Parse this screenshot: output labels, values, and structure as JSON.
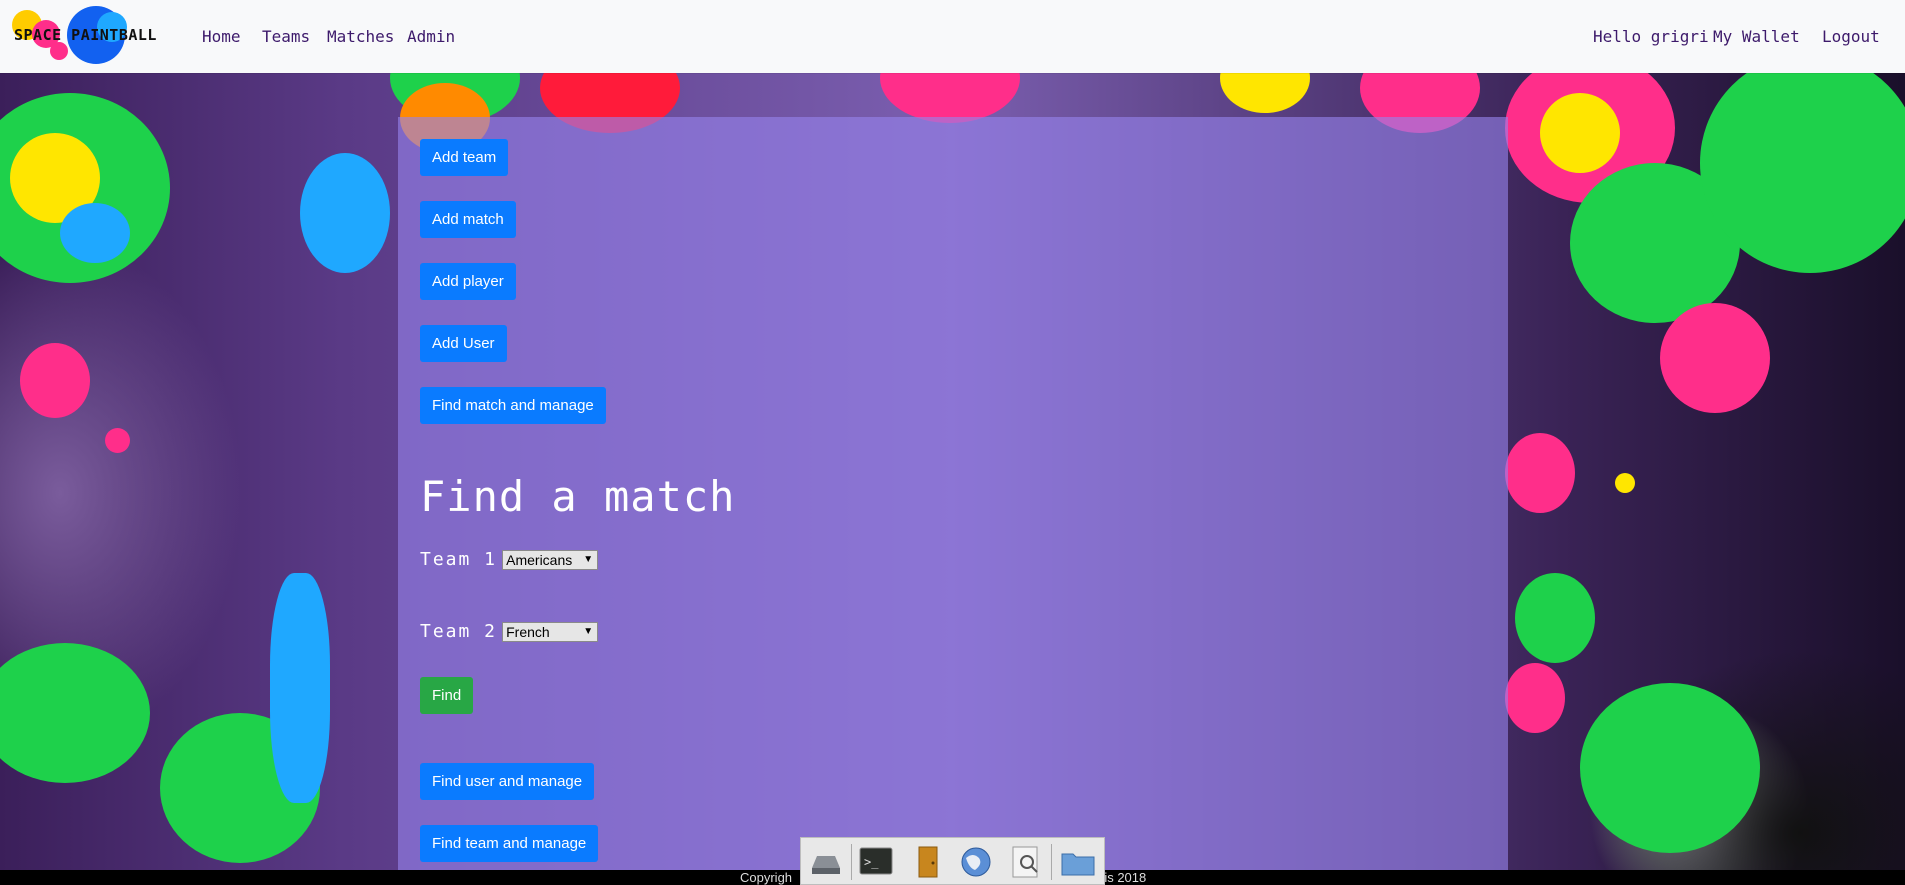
{
  "brand": {
    "logo_text": "SPACE PAINTBALL"
  },
  "nav": {
    "left": [
      {
        "label": "Home"
      },
      {
        "label": "Teams"
      },
      {
        "label": "Matches"
      },
      {
        "label": "Admin"
      }
    ],
    "right": [
      {
        "label": "Hello grigri"
      },
      {
        "label": "My Wallet"
      },
      {
        "label": "Logout"
      }
    ]
  },
  "admin_actions": {
    "add_team": "Add team",
    "add_match": "Add match",
    "add_player": "Add player",
    "add_user": "Add User",
    "find_match_manage": "Find match and manage"
  },
  "find_match": {
    "title": "Find a match",
    "team1_label": "Team 1",
    "team1_value": "Americans",
    "team2_label": "Team 2",
    "team2_value": "French",
    "find_button": "Find"
  },
  "more_actions": {
    "find_user_manage": "Find user and manage",
    "find_team_manage": "Find team and manage"
  },
  "footer": {
    "text_left": "Copyrigh",
    "text_right": "ris 2018"
  },
  "taskbar": {
    "icons": [
      "drive-icon",
      "terminal-icon",
      "file-manager-icon",
      "web-browser-icon",
      "search-icon",
      "folder-icon"
    ]
  },
  "colors": {
    "primary_button": "#0a7bff",
    "success_button": "#28a745",
    "nav_link": "#3d1a6b",
    "panel_overlay": "rgba(150,130,235,0.62)"
  }
}
